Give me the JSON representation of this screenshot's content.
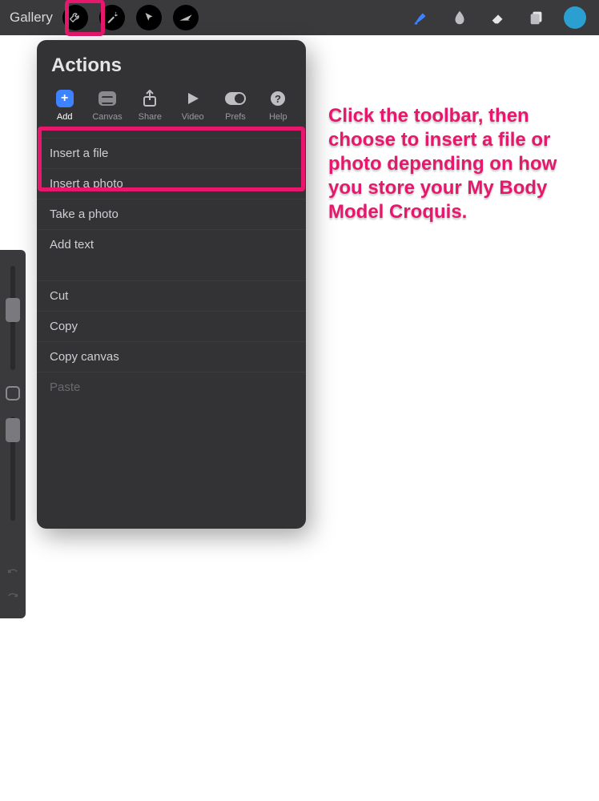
{
  "toolbar": {
    "gallery_label": "Gallery"
  },
  "panel": {
    "title": "Actions",
    "categories": [
      {
        "label": "Add"
      },
      {
        "label": "Canvas"
      },
      {
        "label": "Share"
      },
      {
        "label": "Video"
      },
      {
        "label": "Prefs"
      },
      {
        "label": "Help"
      }
    ],
    "group1": [
      "Insert a file",
      "Insert a photo",
      "Take a photo",
      "Add text"
    ],
    "group2": [
      "Cut",
      "Copy",
      "Copy canvas"
    ],
    "group2_disabled": "Paste"
  },
  "annotation_text": "Click the toolbar, then choose to insert a file or photo depending on how you store your My Body Model Croquis.",
  "colors": {
    "highlight": "#e6176c",
    "accent": "#3d82ff",
    "swatch": "#2c9fd1"
  }
}
